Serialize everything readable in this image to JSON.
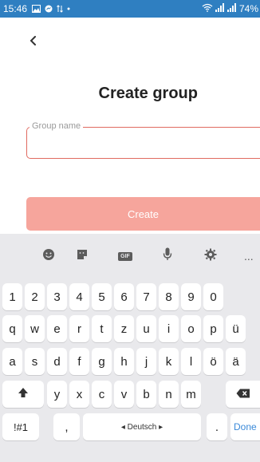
{
  "status_bar": {
    "time": "15:46",
    "battery": "74%"
  },
  "screen": {
    "title": "Create group",
    "group_name_label": "Group name",
    "group_name_value": "",
    "create_button": "Create"
  },
  "keyboard": {
    "toolbar": {
      "gif_label": "GIF",
      "more": "..."
    },
    "digits": [
      "1",
      "2",
      "3",
      "4",
      "5",
      "6",
      "7",
      "8",
      "9",
      "0"
    ],
    "row_q": [
      "q",
      "w",
      "e",
      "r",
      "t",
      "z",
      "u",
      "i",
      "o",
      "p",
      "ü"
    ],
    "row_a": [
      "a",
      "s",
      "d",
      "f",
      "g",
      "h",
      "j",
      "k",
      "l",
      "ö",
      "ä"
    ],
    "row_y": [
      "y",
      "x",
      "c",
      "v",
      "b",
      "n",
      "m"
    ],
    "symbols_key": "!#1",
    "comma_key": ",",
    "space_label": "◂ Deutsch ▸",
    "period_key": ".",
    "done_key": "Done"
  },
  "colors": {
    "accent": "#e06a60",
    "button": "#f6a59c",
    "status_bar": "#2f7fc1"
  }
}
